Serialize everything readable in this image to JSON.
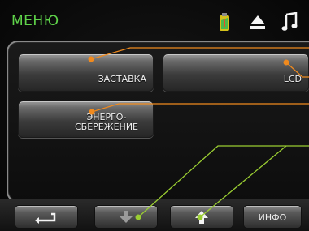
{
  "header": {
    "title": "МЕНЮ",
    "icons": [
      "battery-icon",
      "eject-icon",
      "music-note-icon"
    ],
    "title_color": "#5fd34a"
  },
  "menu": {
    "screensaver_label": "ЗАСТАВКА",
    "lcd_label": "LCD",
    "energy_label_line1": "ЭНЕРГО-",
    "energy_label_line2": "СБЕРЕЖЕНИЕ"
  },
  "bottom": {
    "back_icon": "back-arrow-icon",
    "down_icon": "down-arrow-icon",
    "up_icon": "up-arrow-icon",
    "info_label": "ИНФО"
  },
  "callouts": {
    "orange": "#f08a1e",
    "green": "#9acd32"
  }
}
